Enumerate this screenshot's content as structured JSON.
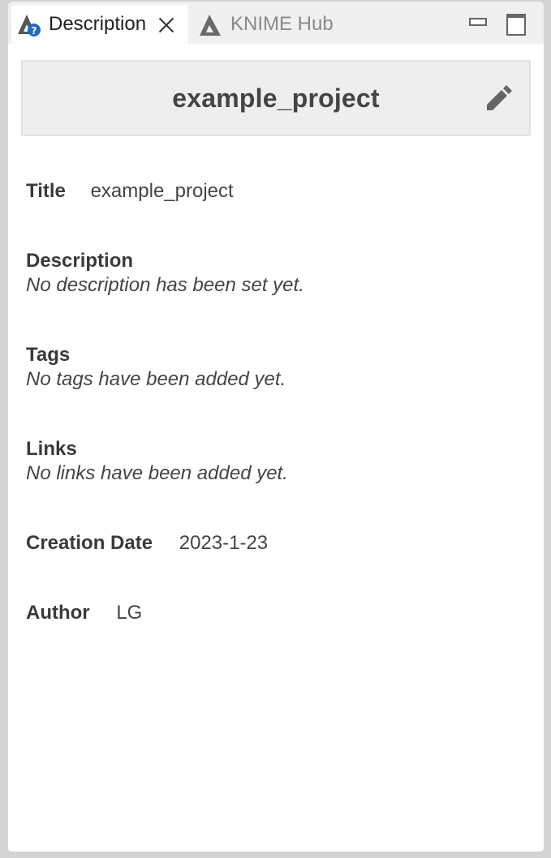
{
  "tabs": [
    {
      "label": "Description",
      "active": true,
      "icon": "description-icon"
    },
    {
      "label": "KNIME Hub",
      "active": false,
      "icon": "knime-hub-icon"
    }
  ],
  "header": {
    "title": "example_project",
    "edit_icon": "pencil-icon"
  },
  "fields": {
    "title": {
      "label": "Title",
      "value": "example_project"
    },
    "description": {
      "label": "Description",
      "value": "No description has been set yet."
    },
    "tags": {
      "label": "Tags",
      "value": "No tags have been added yet."
    },
    "links": {
      "label": "Links",
      "value": "No links have been added yet."
    },
    "creation_date": {
      "label": "Creation Date",
      "value": "2023-1-23"
    },
    "author": {
      "label": "Author",
      "value": "LG"
    }
  },
  "colors": {
    "badge_blue": "#1a6fc4",
    "icon_gray": "#555555",
    "header_bg": "#eeeef0"
  }
}
